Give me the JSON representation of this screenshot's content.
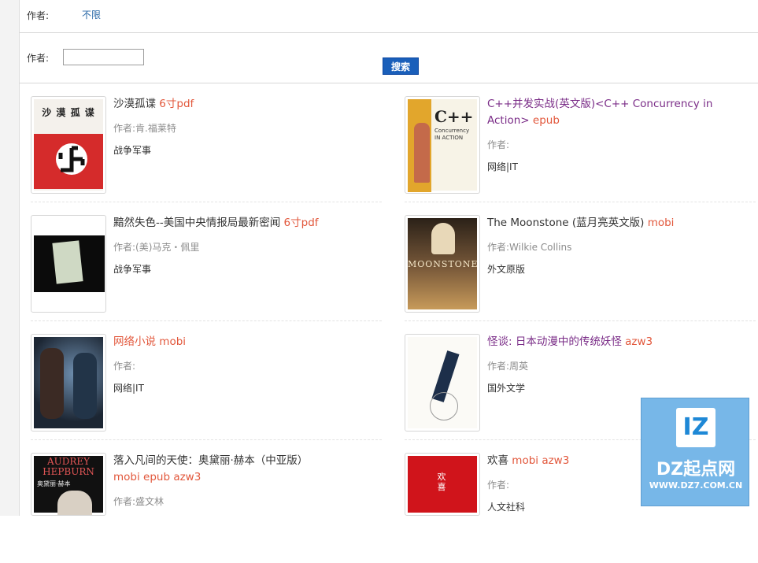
{
  "filters": {
    "author_label_1": "作者:",
    "author_value_1": "不限",
    "author_label_2": "作者:",
    "author_input_value": "",
    "search_button": "搜索"
  },
  "books": [
    {
      "title": "沙漠孤谍",
      "formats": "6寸pdf",
      "author": "作者:肯.福莱特",
      "category": "战争军事"
    },
    {
      "title": "C++并发实战(英文版)<C++ Concurrency in Action>",
      "formats": "epub",
      "author": "作者:",
      "category": "网络|IT"
    },
    {
      "title": "黯然失色--美国中央情报局最新密闻",
      "formats": "6寸pdf",
      "author": "作者:(美)马克・佩里",
      "category": "战争军事"
    },
    {
      "title": "The Moonstone (蓝月亮英文版)",
      "formats": "mobi",
      "author": "作者:Wilkie Collins",
      "category": "外文原版"
    },
    {
      "title": "网络小说",
      "formats": "mobi",
      "author": "作者:",
      "category": "网络|IT"
    },
    {
      "title": "怪谈: 日本动漫中的传统妖怪",
      "formats": "azw3",
      "author": "作者:周英",
      "category": "国外文学"
    },
    {
      "title": "落入凡间的天使：奥黛丽·赫本（中亚版）",
      "formats": "mobi epub azw3",
      "author": "作者:盛文林",
      "category": ""
    },
    {
      "title": "欢喜",
      "formats": "mobi azw3",
      "author": "作者:",
      "category": "人文社科"
    }
  ],
  "covers": {
    "cover_1_text": "沙 漠 孤 谍",
    "cover_2_c": "C++",
    "cover_2_sub": "Concurrency IN ACTION",
    "cover_4_text": "MOONSTONE",
    "cover_7_line1": "AUDREY",
    "cover_7_line2": "HEPBURN",
    "cover_7_cn": "奥黛丽·赫本",
    "cover_8_text": "欢 喜"
  },
  "watermark": {
    "logo": "IZ",
    "brand": "DZ起点网",
    "url": "WWW.DZ7.COM.CN"
  },
  "colors": {
    "format_tag": "#e2573b",
    "link_purple": "#7a2c87",
    "search_button_bg": "#1a5fba",
    "watermark_bg": "#77b7e8"
  }
}
